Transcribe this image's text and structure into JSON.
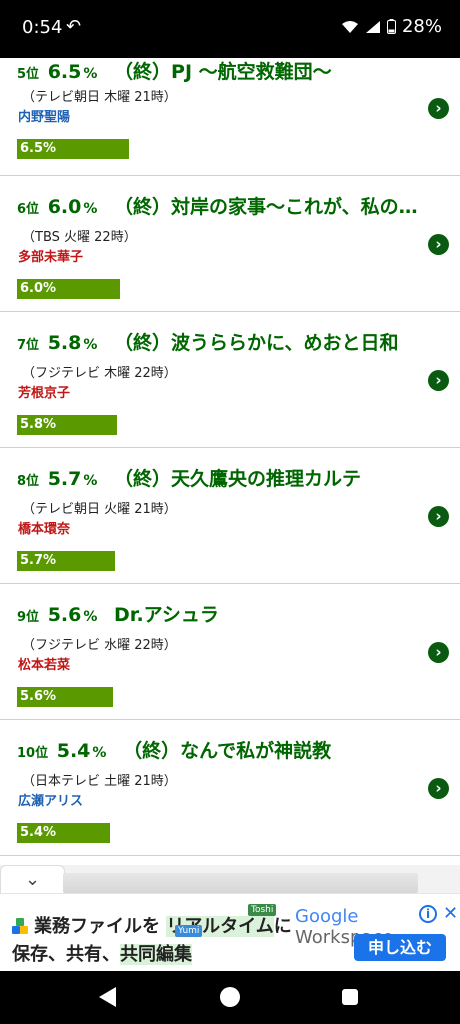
{
  "status_bar": {
    "time": "0:54",
    "battery": "28%",
    "icons": [
      "back-arrow-icon",
      "wifi-icon",
      "signal-icon",
      "battery-icon"
    ]
  },
  "ranking": [
    {
      "rank": "5",
      "rank_suffix": "位",
      "rate": "6.5",
      "pct": "%",
      "show": "（終）PJ 〜航空救難団〜",
      "network": "（テレビ朝日 木曜 21時）",
      "person": "内野聖陽",
      "person_color": "#1f62b3",
      "bar": "6.5%",
      "bar_value": 6.5
    },
    {
      "rank": "6",
      "rank_suffix": "位",
      "rate": "6.0",
      "pct": "%",
      "show": "（終）対岸の家事〜これが、私の生…",
      "network": "（TBS 火曜 22時）",
      "person": "多部未華子",
      "person_color": "#c01616",
      "bar": "6.0%",
      "bar_value": 6.0
    },
    {
      "rank": "7",
      "rank_suffix": "位",
      "rate": "5.8",
      "pct": "%",
      "show": "（終）波うららかに、めおと日和",
      "network": "（フジテレビ 木曜 22時）",
      "person": "芳根京子",
      "person_color": "#c01616",
      "bar": "5.8%",
      "bar_value": 5.8
    },
    {
      "rank": "8",
      "rank_suffix": "位",
      "rate": "5.7",
      "pct": "%",
      "show": "（終）天久鷹央の推理カルテ",
      "network": "（テレビ朝日 火曜 21時）",
      "person": "橋本環奈",
      "person_color": "#c01616",
      "bar": "5.7%",
      "bar_value": 5.7
    },
    {
      "rank": "9",
      "rank_suffix": "位",
      "rate": "5.6",
      "pct": "%",
      "show": "Dr.アシュラ",
      "network": "（フジテレビ 水曜 22時）",
      "person": "松本若菜",
      "person_color": "#c01616",
      "bar": "5.6%",
      "bar_value": 5.6
    },
    {
      "rank": "10",
      "rank_suffix": "位",
      "rate": "5.4",
      "pct": "%",
      "show": "（終）なんで私が神説教",
      "network": "（日本テレビ 土曜 21時）",
      "person": "広瀬アリス",
      "person_color": "#1f62b3",
      "bar": "5.4%",
      "bar_value": 5.4
    }
  ],
  "ad": {
    "line1_prefix": "業務ファイルを ",
    "line1_highlight": "リアルタイム",
    "line1_suffix": "に",
    "line2_prefix": "保存、共有、",
    "line2_highlight": "共同編集",
    "badge": "Toshi",
    "badge2": "Yumi",
    "google_brand": "Google",
    "google_product": " Workspace",
    "cta": "申し込む",
    "info_icon": "i",
    "close_icon": "✕",
    "collapse_icon": "⌄"
  },
  "colors": {
    "accent_green": "#006600",
    "bar_green": "#5a9a00",
    "chevron_green": "#0a5a12",
    "ad_blue": "#1a73e8"
  }
}
